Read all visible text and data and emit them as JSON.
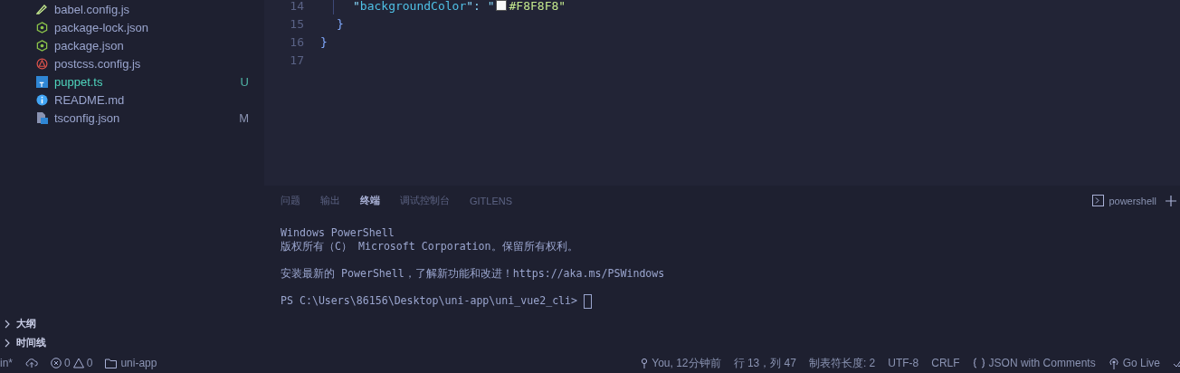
{
  "explorer": {
    "files": [
      {
        "name": "babel.config.js",
        "kind": "babel",
        "untracked": false
      },
      {
        "name": "package-lock.json",
        "kind": "node",
        "untracked": false
      },
      {
        "name": "package.json",
        "kind": "node",
        "untracked": false
      },
      {
        "name": "postcss.config.js",
        "kind": "postcss",
        "untracked": false
      },
      {
        "name": "puppet.ts",
        "kind": "ts",
        "status": "U",
        "untracked": true
      },
      {
        "name": "README.md",
        "kind": "info",
        "untracked": false
      },
      {
        "name": "tsconfig.json",
        "kind": "tsconfig",
        "status": "M",
        "untracked": false
      }
    ],
    "sections": [
      {
        "label": "大纲",
        "expanded": false
      },
      {
        "label": "时间线",
        "expanded": false
      }
    ]
  },
  "editor": {
    "lines": [
      {
        "number": "14",
        "kind": "property",
        "tokens": [
          {
            "kind": "punct",
            "text": "\""
          },
          {
            "kind": "key",
            "text": "backgroundColor"
          },
          {
            "kind": "punct",
            "text": "\": \""
          },
          {
            "kind": "swatch",
            "color": "#f8f8f8"
          },
          {
            "kind": "string",
            "text": "#F8F8F8\""
          }
        ]
      },
      {
        "number": "15",
        "kind": "inner",
        "tokens": [
          {
            "kind": "brace",
            "text": "}"
          }
        ]
      },
      {
        "number": "16",
        "kind": "outer",
        "tokens": [
          {
            "kind": "brace",
            "text": "}"
          }
        ]
      },
      {
        "number": "17",
        "kind": "blank"
      }
    ]
  },
  "panel": {
    "tabs": [
      {
        "label": "问题",
        "selected": false
      },
      {
        "label": "输出",
        "selected": false
      },
      {
        "label": "终端",
        "selected": true
      },
      {
        "label": "调试控制台",
        "selected": false
      },
      {
        "label": "GITLENS",
        "selected": false
      }
    ],
    "shell": "powershell",
    "terminal": [
      [
        "Windows PowerShell",
        "版权所有（C） Microsoft Corporation。保留所有权利。"
      ],
      [
        "安装最新的 PowerShell，了解新功能和改进！https://aka.ms/PSWindows"
      ]
    ],
    "prompt": "PS C:\\Users\\86156\\Desktop\\uni-app\\uni_vue2_cli>"
  },
  "status_bar": {
    "branch": "in*",
    "errors": "0",
    "warnings": "0",
    "folder": "uni-app",
    "right": [
      {
        "kind": "blame",
        "text": "You, 12分钟前"
      },
      {
        "kind": "text",
        "text": "行 13，列 47"
      },
      {
        "kind": "text",
        "text": "制表符长度: 2"
      },
      {
        "kind": "text",
        "text": "UTF-8"
      },
      {
        "kind": "text",
        "text": "CRLF"
      },
      {
        "kind": "language",
        "text": "JSON with Comments"
      },
      {
        "kind": "live",
        "text": "Go Live"
      }
    ]
  }
}
